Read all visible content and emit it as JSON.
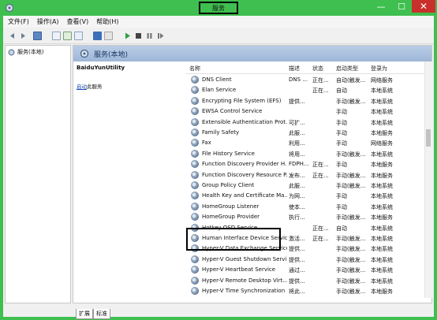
{
  "window": {
    "title": "服务",
    "controls": {
      "minimize": "—",
      "maximize": "☐",
      "close": "✕"
    }
  },
  "menu": [
    "文件(F)",
    "操作(A)",
    "查看(V)",
    "帮助(H)"
  ],
  "tree": {
    "item": "服务(本地)"
  },
  "panel": {
    "header": "服务(本地)",
    "selected_service": "BaiduYunUtility",
    "link_text": "启动",
    "link_suffix": "此服务"
  },
  "list": {
    "columns": {
      "name": "名称",
      "desc": "描述",
      "state": "状态",
      "startup": "启动类型",
      "logon": "登录为"
    },
    "rows": [
      {
        "name": "DNS Client",
        "desc": "DNS ...",
        "state": "正在...",
        "startup": "自动(触发...",
        "logon": "网络服务"
      },
      {
        "name": "Elan Service",
        "desc": "",
        "state": "正在...",
        "startup": "自动",
        "logon": "本地系统"
      },
      {
        "name": "Encrypting File System (EFS)",
        "desc": "提供...",
        "state": "",
        "startup": "手动(触发...",
        "logon": "本地系统"
      },
      {
        "name": "EWSA Control Service",
        "desc": "",
        "state": "",
        "startup": "手动",
        "logon": "本地系统"
      },
      {
        "name": "Extensible Authentication Prot...",
        "desc": "可扩...",
        "state": "",
        "startup": "手动",
        "logon": "本地系统"
      },
      {
        "name": "Family Safety",
        "desc": "此服...",
        "state": "",
        "startup": "手动",
        "logon": "本地服务"
      },
      {
        "name": "Fax",
        "desc": "利用...",
        "state": "",
        "startup": "手动",
        "logon": "网络服务"
      },
      {
        "name": "File History Service",
        "desc": "将用...",
        "state": "",
        "startup": "手动(触发...",
        "logon": "本地系统"
      },
      {
        "name": "Function Discovery Provider H...",
        "desc": "FDPH...",
        "state": "正在...",
        "startup": "手动",
        "logon": "本地服务"
      },
      {
        "name": "Function Discovery Resource P...",
        "desc": "发布...",
        "state": "正在...",
        "startup": "手动(触发...",
        "logon": "本地服务"
      },
      {
        "name": "Group Policy Client",
        "desc": "此服...",
        "state": "",
        "startup": "手动(触发...",
        "logon": "本地系统"
      },
      {
        "name": "Health Key and Certificate Ma...",
        "desc": "为网...",
        "state": "",
        "startup": "手动",
        "logon": "本地系统"
      },
      {
        "name": "HomeGroup Listener",
        "desc": "使本...",
        "state": "",
        "startup": "手动",
        "logon": "本地系统"
      },
      {
        "name": "HomeGroup Provider",
        "desc": "执行...",
        "state": "",
        "startup": "手动(触发...",
        "logon": "本地服务"
      },
      {
        "name": "Hotkey OSD Service",
        "desc": "",
        "state": "正在...",
        "startup": "自动",
        "logon": "本地系统"
      },
      {
        "name": "Human Interface Device Service",
        "desc": "激活...",
        "state": "正在...",
        "startup": "手动(触发...",
        "logon": "本地系统"
      },
      {
        "name": "Hyper-V Data Exchange Service",
        "desc": "提供...",
        "state": "",
        "startup": "手动(触发...",
        "logon": "本地系统"
      },
      {
        "name": "Hyper-V Guest Shutdown Servi...",
        "desc": "提供...",
        "state": "",
        "startup": "手动(触发...",
        "logon": "本地系统"
      },
      {
        "name": "Hyper-V Heartbeat Service",
        "desc": "通过...",
        "state": "",
        "startup": "手动(触发...",
        "logon": "本地系统"
      },
      {
        "name": "Hyper-V Remote Desktop Virt...",
        "desc": "提供...",
        "state": "",
        "startup": "手动(触发...",
        "logon": "本地系统"
      },
      {
        "name": "Hyper-V Time Synchronization ...",
        "desc": "将此...",
        "state": "",
        "startup": "手动(触发...",
        "logon": "本地服务"
      }
    ]
  },
  "tabs": [
    "扩展",
    "标准"
  ]
}
